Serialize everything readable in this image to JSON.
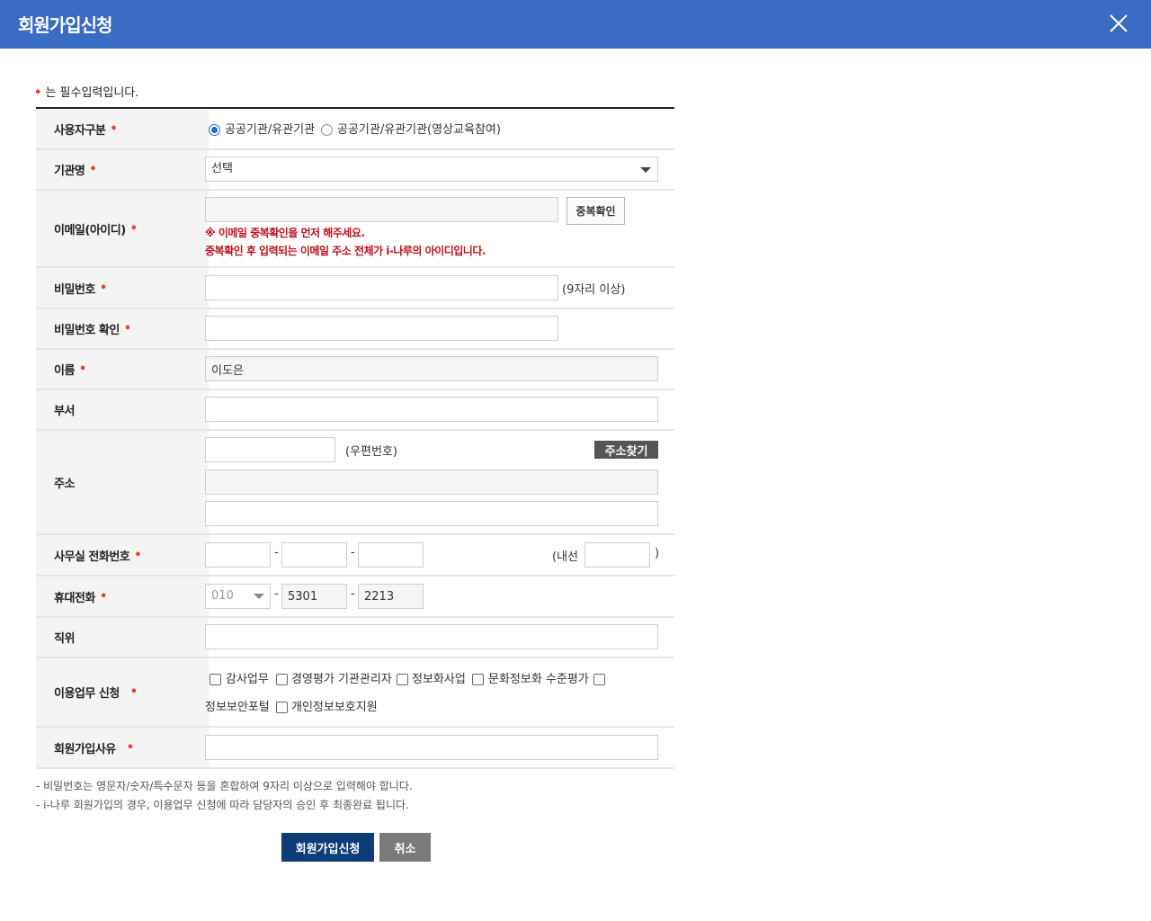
{
  "window": {
    "title": "회원가입신청",
    "close_icon": "close-icon"
  },
  "required_note": "는 필수입력입니다.",
  "required_mark": "•",
  "fields": {
    "user_type": {
      "label": "사용자구분",
      "options": [
        "공공기관/유관기관",
        "공공기관/유관기관(영상교육참여)"
      ],
      "selected": "공공기관/유관기관"
    },
    "org_name": {
      "label": "기관명",
      "value": "선택"
    },
    "email": {
      "label": "이메일(아이디)",
      "value": "",
      "check_button": "중복확인",
      "warning1": "※ 이메일 중복확인을 먼저 해주세요.",
      "warning2": "중복확인 후 입력되는 이메일 주소 전체가 i-나루의 아이디입니다."
    },
    "password": {
      "label": "비밀번호",
      "hint": "(9자리 이상)"
    },
    "password_confirm": {
      "label": "비밀번호 확인"
    },
    "name": {
      "label": "이름",
      "value": "이도은"
    },
    "department": {
      "label": "부서",
      "value": ""
    },
    "address": {
      "label": "주소",
      "postcode_label": "(우편번호)",
      "search_button": "주소찾기"
    },
    "office_phone": {
      "label": "사무실 전화번호",
      "separator": "-",
      "ext_label": "(내선",
      "ext_close": ")"
    },
    "mobile": {
      "label": "휴대전화",
      "prefix": "010",
      "mid": "5301",
      "last": "2213",
      "separator": "-"
    },
    "position": {
      "label": "직위",
      "value": ""
    },
    "services": {
      "label": "이용업무 신청",
      "options": [
        "감사업무",
        "경영평가 기관관리자",
        "정보화사업",
        "문화정보화 수준평가",
        "정보보안포털",
        "개인정보보호지원"
      ]
    },
    "reason": {
      "label": "회원가입사유",
      "value": ""
    }
  },
  "notes": [
    "- 비밀번호는 영문자/숫자/특수문자 등을 혼합하여 9자리 이상으로 입력해야 합니다.",
    "- i-나루 회원가입의 경우, 이용업무 신청에 따라 담당자의 승인 후 최종완료 됩니다."
  ],
  "buttons": {
    "submit": "회원가입신청",
    "cancel": "취소"
  },
  "colors": {
    "header": "#3a6cc4",
    "required": "#e8442a",
    "warning": "#c0101c",
    "submit": "#0d3c78",
    "cancel": "#7a7a7a"
  }
}
